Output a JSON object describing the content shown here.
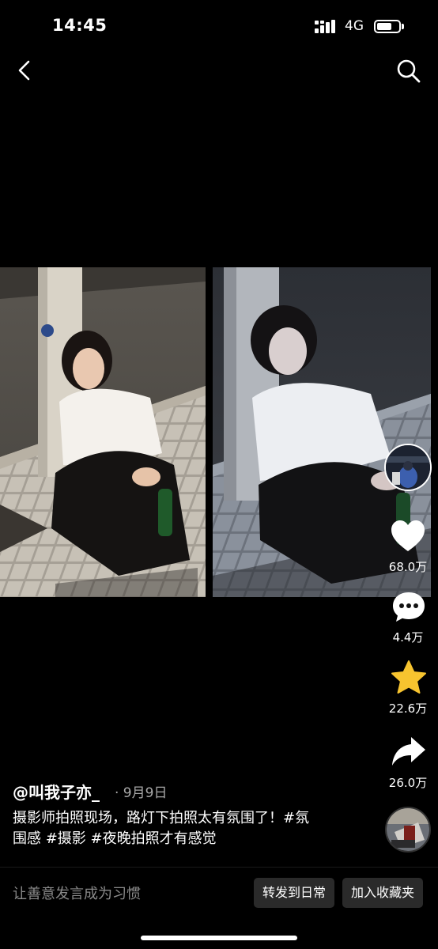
{
  "status_bar": {
    "time": "14:45",
    "network": "4G",
    "battery_level": 0.7
  },
  "nav": {
    "back_icon": "chevron-left-icon",
    "search_icon": "search-icon"
  },
  "actions": {
    "likes": "68.0万",
    "comments": "4.4万",
    "favorites": "22.6万",
    "shares": "26.0万",
    "colors": {
      "star": "#f7c42f",
      "icon": "#ffffff"
    }
  },
  "post": {
    "author": "@叫我子亦_",
    "date": "· 9月9日",
    "caption_line1": "摄影师拍照现场，路灯下拍照太有氛围了！#氛",
    "caption_line2": "围感 #摄影 #夜晚拍照才有感觉"
  },
  "bottom": {
    "comment_placeholder": "让善意发言成为习惯",
    "forward_label": "转发到日常",
    "favorite_label": "加入收藏夹"
  }
}
